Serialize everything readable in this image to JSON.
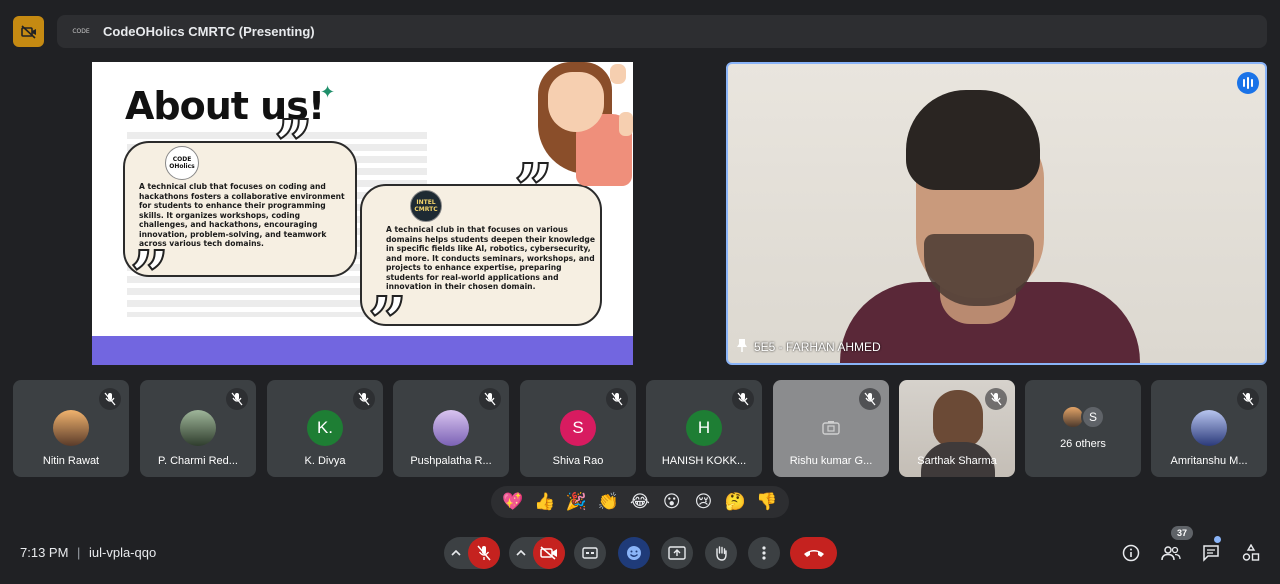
{
  "header": {
    "presentation_title": "CodeOHolics CMRTC (Presenting)",
    "badge_icon": "camera-off-icon",
    "present_icon_text": "CODE"
  },
  "slide": {
    "title": "About us!",
    "card1": {
      "logo_text": "CODE\nOHolics",
      "text": "A technical club that focuses on coding and hackathons fosters a collaborative environment for students to enhance their programming skills. It organizes workshops, coding challenges, and hackathons, encouraging innovation, problem-solving, and teamwork across various tech domains."
    },
    "card2": {
      "logo_text": "INTEL\nCMRTC",
      "text": "A technical club in that focuses on various domains helps students deepen their knowledge in specific fields like AI, robotics, cybersecurity, and more. It conducts seminars, workshops, and projects to enhance expertise, preparing students for real-world applications and innovation in their chosen domain."
    },
    "band_color": "#7266e0"
  },
  "main_video": {
    "name": "5E5 - FARHAN AHMED",
    "speaking": true
  },
  "participants": [
    {
      "name": "Nitin Rawat",
      "avatar_type": "photo",
      "avatar_color": "#c77a3a"
    },
    {
      "name": "P. Charmi Red...",
      "avatar_type": "photo",
      "avatar_color": "#4a5e4a"
    },
    {
      "name": "K. Divya",
      "avatar_type": "letter",
      "initial": "K.",
      "avatar_color": "#1e7e34"
    },
    {
      "name": "Pushpalatha R...",
      "avatar_type": "photo",
      "avatar_color": "#9b86c9"
    },
    {
      "name": "Shiva Rao",
      "avatar_type": "letter",
      "initial": "S",
      "avatar_color": "#d81b60"
    },
    {
      "name": "HANISH KOKK...",
      "avatar_type": "letter",
      "initial": "H",
      "avatar_color": "#1e7e34"
    },
    {
      "name": "Rishu kumar G...",
      "avatar_type": "camera-off"
    },
    {
      "name": "Sarthak Sharma",
      "avatar_type": "video"
    },
    {
      "name": "26 others",
      "avatar_type": "group",
      "initial": "S"
    },
    {
      "name": "Amritanshu M...",
      "avatar_type": "photo",
      "avatar_color": "#4a5ba8"
    }
  ],
  "reactions": [
    "💖",
    "👍",
    "🎉",
    "👏",
    "😂",
    "😮",
    "😢",
    "🤔",
    "👎"
  ],
  "footer": {
    "time": "7:13 PM",
    "separator": "|",
    "meeting_code": "iul-vpla-qqo",
    "participant_count": "37"
  }
}
